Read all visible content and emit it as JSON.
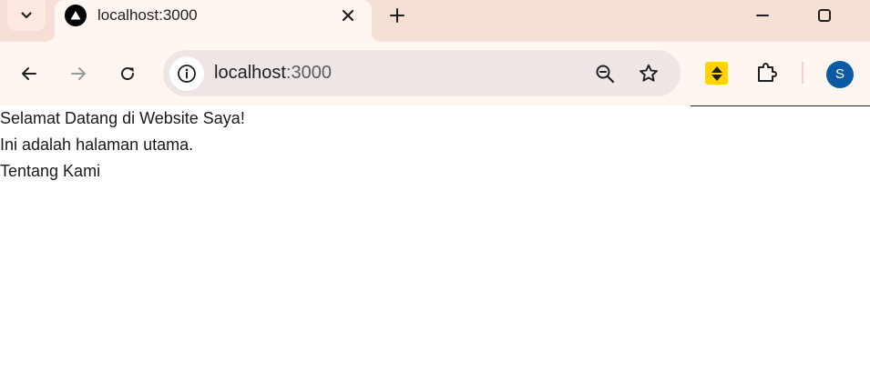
{
  "browser": {
    "tab": {
      "title": "localhost:3000",
      "favicon": "triangle-favicon-icon"
    },
    "icons": {
      "tab_search": "chevron-down-icon",
      "tab_close": "close-icon",
      "new_tab": "plus-icon",
      "minimize": "minimize-icon",
      "maximize": "maximize-icon",
      "back": "arrow-left-icon",
      "forward": "arrow-right-icon",
      "reload": "reload-icon",
      "site_info": "info-icon",
      "zoom": "zoom-out-icon",
      "bookmark": "star-icon",
      "extension": "yellow-extension-icon",
      "extensions_menu": "puzzle-icon"
    },
    "address_bar": {
      "host": "localhost",
      "port": ":3000"
    },
    "profile": {
      "initial": "S",
      "color": "#0b5aa3"
    },
    "colors": {
      "tabstrip": "#f6e0d6",
      "toolbar": "#fff6f2",
      "omnibox": "#ede6e5",
      "extension_yellow": "#ffd400"
    }
  },
  "page": {
    "heading": "Selamat Datang di Website Saya!",
    "paragraph": "Ini adalah halaman utama.",
    "link": "Tentang Kami"
  }
}
